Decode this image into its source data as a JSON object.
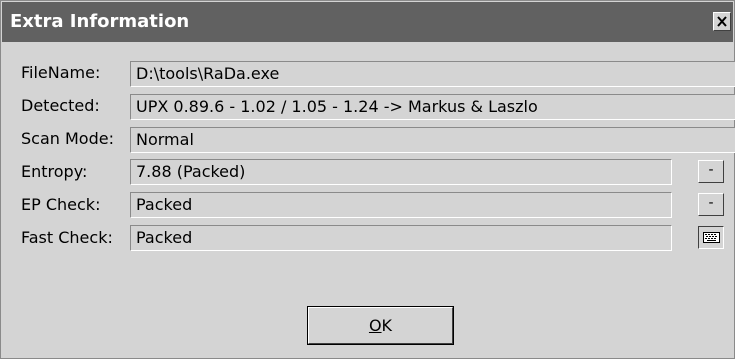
{
  "window": {
    "title": "Extra Information"
  },
  "rows": [
    {
      "label": "FileName:",
      "value": "D:\\tools\\RaDa.exe"
    },
    {
      "label": "Detected:",
      "value": "UPX 0.89.6 - 1.02 / 1.05 - 1.24 -> Markus & Laszlo"
    },
    {
      "label": "Scan Mode:",
      "value": "Normal"
    },
    {
      "label": "Entropy:",
      "value": "7.88 (Packed)",
      "button": "-"
    },
    {
      "label": "EP Check:",
      "value": "Packed",
      "button": "-"
    },
    {
      "label": "Fast Check:",
      "value": "Packed",
      "button_icon": "keyboard-icon"
    }
  ],
  "buttons": {
    "ok_mnemonic": "O",
    "ok_rest": "K"
  },
  "icons": {
    "close": "close-icon"
  },
  "colors": {
    "titlebar": "#616161",
    "face": "#d4d4d4"
  }
}
